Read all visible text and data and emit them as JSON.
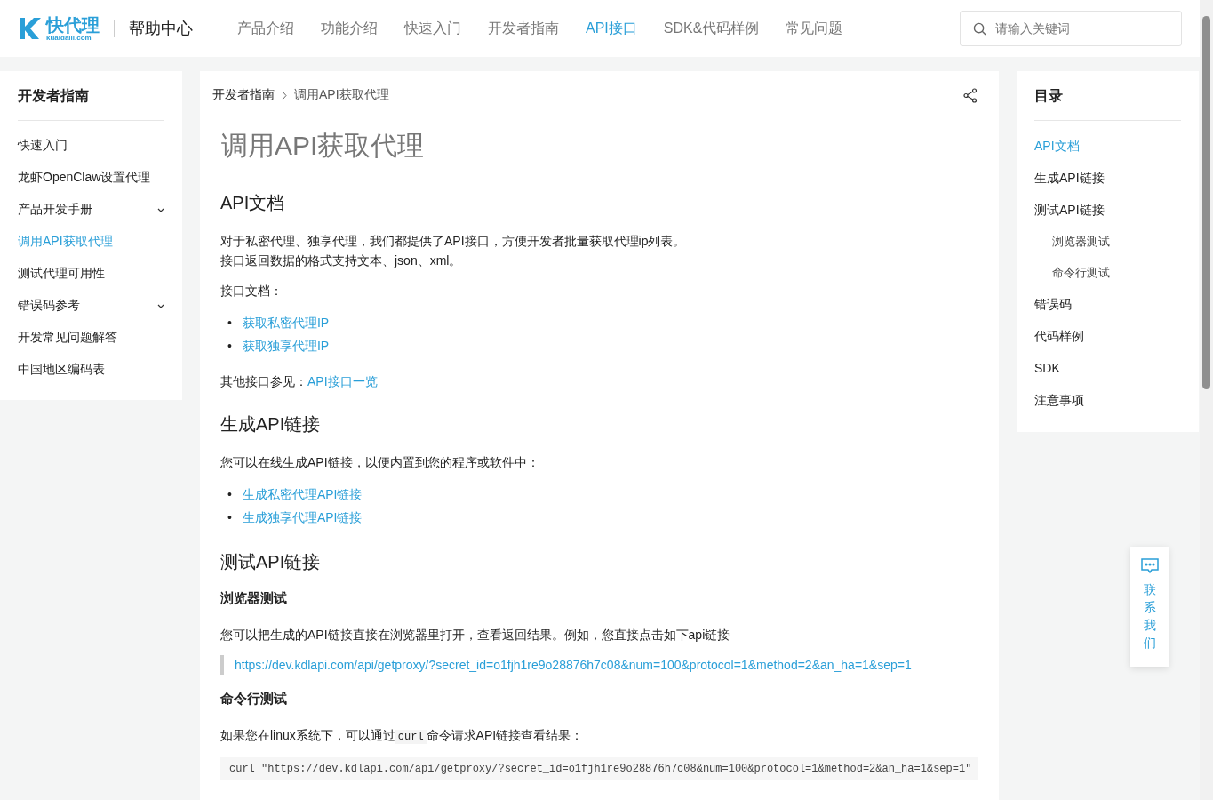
{
  "header": {
    "logo": {
      "name": "快代理",
      "domain": "kuaidaili.com"
    },
    "site_title": "帮助中心",
    "nav": [
      {
        "label": "产品介绍",
        "selected": false
      },
      {
        "label": "功能介绍",
        "selected": false
      },
      {
        "label": "快速入门",
        "selected": false
      },
      {
        "label": "开发者指南",
        "selected": false
      },
      {
        "label": "API接口",
        "selected": true
      },
      {
        "label": "SDK&代码样例",
        "selected": false
      },
      {
        "label": "常见问题",
        "selected": false
      }
    ],
    "search": {
      "placeholder": "请输入关键词"
    }
  },
  "sidebar": {
    "title": "开发者指南",
    "items": [
      {
        "label": "快速入门",
        "selected": false,
        "expandable": false
      },
      {
        "label": "龙虾OpenClaw设置代理",
        "selected": false,
        "expandable": false
      },
      {
        "label": "产品开发手册",
        "selected": false,
        "expandable": true
      },
      {
        "label": "调用API获取代理",
        "selected": true,
        "expandable": false
      },
      {
        "label": "测试代理可用性",
        "selected": false,
        "expandable": false
      },
      {
        "label": "错误码参考",
        "selected": false,
        "expandable": true
      },
      {
        "label": "开发常见问题解答",
        "selected": false,
        "expandable": false
      },
      {
        "label": "中国地区编码表",
        "selected": false,
        "expandable": false
      }
    ]
  },
  "breadcrumb": [
    "开发者指南",
    "调用API获取代理"
  ],
  "article": {
    "title": "调用API获取代理",
    "blocks": [
      {
        "kind": "h2",
        "text": "API文档"
      },
      {
        "kind": "p",
        "lines": [
          "对于私密代理、独享代理，我们都提供了API接口，方便开发者批量获取代理ip列表。",
          "接口返回数据的格式支持文本、json、xml。"
        ]
      },
      {
        "kind": "p",
        "lines": [
          "接口文档："
        ]
      },
      {
        "kind": "links",
        "marker": "•",
        "items": [
          "获取私密代理IP",
          "获取独享代理IP"
        ]
      },
      {
        "kind": "pl",
        "text": "其他接口参见：",
        "link": "API接口一览"
      },
      {
        "kind": "h2",
        "text": "生成API链接"
      },
      {
        "kind": "p",
        "lines": [
          "您可以在线生成API链接，以便内置到您的程序或软件中："
        ]
      },
      {
        "kind": "links",
        "marker": "•",
        "items": [
          "生成私密代理API链接",
          "生成独享代理API链接"
        ]
      },
      {
        "kind": "h2",
        "text": "测试API链接"
      },
      {
        "kind": "h3",
        "text": "浏览器测试"
      },
      {
        "kind": "p",
        "lines": [
          "您可以把生成的API链接直接在浏览器里打开，查看返回结果。例如，您直接点击如下api链接"
        ]
      },
      {
        "kind": "quote",
        "text": "https://dev.kdlapi.com/api/getproxy/?secret_id=o1fjh1re9o28876h7c08&num=100&protocol=1&method=2&an_ha=1&sep=1"
      },
      {
        "kind": "h3",
        "text": "命令行测试"
      },
      {
        "kind": "pc",
        "before": "如果您在linux系统下，可以通过",
        "code": "curl",
        "after": "命令请求API链接查看结果："
      },
      {
        "kind": "code",
        "text": "curl \"https://dev.kdlapi.com/api/getproxy/?secret_id=o1fjh1re9o28876h7c08&num=100&protocol=1&method=2&an_ha=1&sep=1\""
      }
    ]
  },
  "toc": {
    "title": "目录",
    "items": [
      {
        "label": "API文档",
        "selected": true
      },
      {
        "label": "生成API链接",
        "selected": false
      },
      {
        "label": "测试API链接",
        "selected": false,
        "children": [
          {
            "label": "浏览器测试",
            "selected": false
          },
          {
            "label": "命令行测试",
            "selected": false
          }
        ]
      },
      {
        "label": "错误码",
        "selected": false
      },
      {
        "label": "代码样例",
        "selected": false
      },
      {
        "label": "SDK",
        "selected": false
      },
      {
        "label": "注意事项",
        "selected": false
      }
    ]
  },
  "contact": {
    "label": "联系我们"
  }
}
